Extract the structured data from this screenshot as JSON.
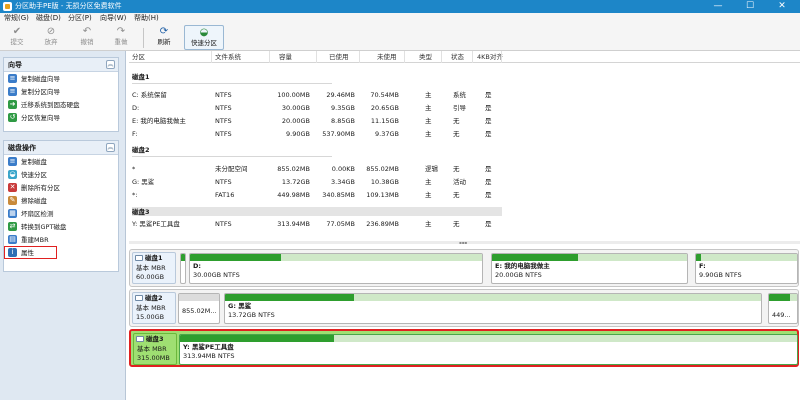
{
  "window": {
    "title": "分区助手PE版 - 无损分区免费软件",
    "minimize_glyph": "—",
    "maximize_glyph": "☐",
    "close_glyph": "✕"
  },
  "menu": [
    "常规(G)",
    "磁盘(D)",
    "分区(P)",
    "向导(W)",
    "帮助(H)"
  ],
  "toolbar": {
    "commit": "提交",
    "discard": "放弃",
    "undo": "撤销",
    "redo": "重做",
    "refresh": "刷新",
    "quick_partition": "快速分区"
  },
  "icons": {
    "commit": "✔",
    "discard": "⊘",
    "undo": "↶",
    "redo": "↷",
    "refresh": "⟳",
    "quick": "◒",
    "collapse": "︽"
  },
  "sidebar": {
    "wizard_title": "向导",
    "wizard_items": [
      {
        "label": "复制磁盘向导",
        "icon": "≡",
        "color": "#3a7cc9"
      },
      {
        "label": "复制分区向导",
        "icon": "≡",
        "color": "#3a7cc9"
      },
      {
        "label": "迁移系统到固态硬盘",
        "icon": "➜",
        "color": "#2f9a44"
      },
      {
        "label": "分区恢复向导",
        "icon": "↺",
        "color": "#2f9a44"
      }
    ],
    "disk_ops_title": "磁盘操作",
    "disk_ops_items": [
      {
        "label": "复制磁盘",
        "icon": "≡",
        "color": "#3a7cc9"
      },
      {
        "label": "快速分区",
        "icon": "◒",
        "color": "#3aa5c9"
      },
      {
        "label": "删除所有分区",
        "icon": "✕",
        "color": "#c93a3a"
      },
      {
        "label": "擦除磁盘",
        "icon": "✎",
        "color": "#c98a3a"
      },
      {
        "label": "坏扇区检测",
        "icon": "▦",
        "color": "#3a7cc9"
      },
      {
        "label": "转换到GPT磁盘",
        "icon": "⇄",
        "color": "#2f9a44"
      },
      {
        "label": "重建MBR",
        "icon": "▤",
        "color": "#3a7cc9"
      },
      {
        "label": "属性",
        "icon": "i",
        "color": "#2f6fb5"
      }
    ]
  },
  "table": {
    "columns": [
      "分区",
      "文件系统",
      "容量",
      "已使用",
      "未使用",
      "类型",
      "状态",
      "4KB对齐"
    ],
    "groups": [
      {
        "name": "磁盘1",
        "rows": [
          [
            "C: 系统保留",
            "NTFS",
            "100.00MB",
            "29.46MB",
            "70.54MB",
            "主",
            "系统",
            "是"
          ],
          [
            "D:",
            "NTFS",
            "30.00GB",
            "9.35GB",
            "20.65GB",
            "主",
            "引导",
            "是"
          ],
          [
            "E: 我的电脑我做主",
            "NTFS",
            "20.00GB",
            "8.85GB",
            "11.15GB",
            "主",
            "无",
            "是"
          ],
          [
            "F:",
            "NTFS",
            "9.90GB",
            "537.90MB",
            "9.37GB",
            "主",
            "无",
            "是"
          ]
        ]
      },
      {
        "name": "磁盘2",
        "rows": [
          [
            "*",
            "未分配空间",
            "855.02MB",
            "0.00KB",
            "855.02MB",
            "逻辑",
            "无",
            "是"
          ],
          [
            "G: 黑鲨",
            "NTFS",
            "13.72GB",
            "3.34GB",
            "10.38GB",
            "主",
            "活动",
            "是"
          ],
          [
            "*:",
            "FAT16",
            "449.98MB",
            "340.85MB",
            "109.13MB",
            "主",
            "无",
            "是"
          ]
        ]
      },
      {
        "name": "磁盘3",
        "rows": [
          [
            "Y: 黑鲨PE工具盘",
            "NTFS",
            "313.94MB",
            "77.05MB",
            "236.89MB",
            "主",
            "无",
            "是"
          ]
        ]
      }
    ]
  },
  "disk_map": [
    {
      "name": "磁盘1",
      "type": "基本 MBR",
      "size": "60.00GB",
      "partitions": [
        {
          "label": "D:",
          "size": "30.00GB NTFS",
          "usage_fraction": 0.31
        },
        {
          "label": "E: 我的电脑我做主",
          "size": "20.00GB NTFS",
          "usage_fraction": 0.44
        },
        {
          "label": "F:",
          "size": "9.90GB NTFS",
          "usage_fraction": 0.05
        }
      ]
    },
    {
      "name": "磁盘2",
      "type": "基本 MBR",
      "size": "15.00GB",
      "partitions": [
        {
          "label": "",
          "size": "855.02M...",
          "usage_fraction": 0.0
        },
        {
          "label": "G: 黑鲨",
          "size": "13.72GB NTFS",
          "usage_fraction": 0.24
        },
        {
          "label": "",
          "size": "449...",
          "usage_fraction": 0.76
        }
      ]
    },
    {
      "name": "磁盘3",
      "type": "基本 MBR",
      "size": "315.00MB",
      "partitions": [
        {
          "label": "Y: 黑鲨PE工具盘",
          "size": "313.94MB NTFS",
          "usage_fraction": 0.25
        }
      ]
    }
  ],
  "colors": {
    "titlebar": "#1d86c8",
    "used": "#2e9e2e",
    "selected_disk": "#9fdf72",
    "highlight_border": "#e02020"
  }
}
